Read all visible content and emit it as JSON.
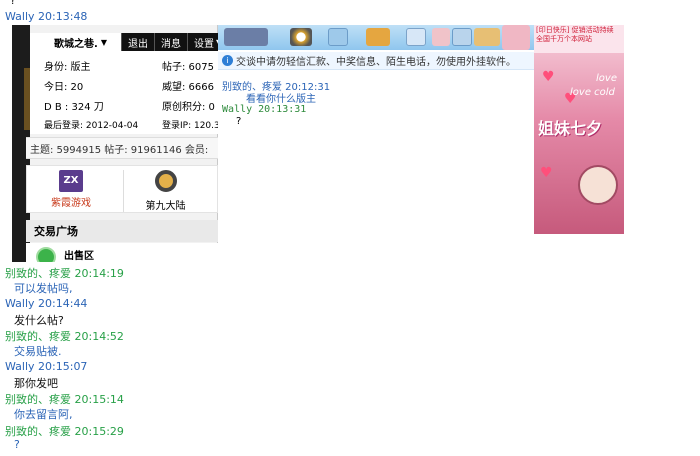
{
  "transcript_top": {
    "fragment": "?",
    "header": "Wally 20:13:48"
  },
  "forum": {
    "menu": [
      "歌城之巷.",
      "退出",
      "消息",
      "设置"
    ],
    "info": {
      "left": [
        "身份: 版主",
        "今日: 20",
        "D B : 324 刀",
        "最后登录: 2012-04-04"
      ],
      "right": [
        "帖子: 6075",
        "威望: 6666",
        "原创积分: 0",
        "登录IP: 120.3"
      ]
    },
    "stats": "主题: 5994915  帖子: 91961146  会员:",
    "apps": [
      "紫霞游戏",
      "第九大陆"
    ],
    "zx_label": "ZX",
    "section_title": "交易广场",
    "sell_label": "出售区"
  },
  "chat_panel": {
    "notice": "交谈中请勿轻信汇款、中奖信息、陌生电话，勿使用外挂软件。",
    "messages": [
      {
        "sender": "别致的、疼爱  20:12:31",
        "text": "看看你什么版主"
      },
      {
        "sender": "Wally  20:13:31",
        "text": "?"
      }
    ]
  },
  "ad": {
    "top_text": "[印日快乐] 促销活动持续\n全国千万个本网站",
    "lines": [
      "love",
      "love cold"
    ],
    "big_text": "姐妹七夕"
  },
  "transcript": [
    {
      "sender": "别致的、疼爱 20:14:19",
      "sender_color": "green",
      "text": "可以发帖吗,",
      "text_color": "blue"
    },
    {
      "sender": "Wally 20:14:44",
      "sender_color": "blue",
      "text": "发什么帖?",
      "text_color": "black"
    },
    {
      "sender": "别致的、疼爱 20:14:52",
      "sender_color": "green",
      "text": "交易贴被.",
      "text_color": "blue"
    },
    {
      "sender": "Wally 20:15:07",
      "sender_color": "blue",
      "text": "那你发吧",
      "text_color": "black"
    },
    {
      "sender": "别致的、疼爱 20:15:14",
      "sender_color": "green",
      "text": "你去留言阿,",
      "text_color": "blue"
    },
    {
      "sender": "别致的、疼爱 20:15:29",
      "sender_color": "green",
      "text": "?",
      "text_color": "blue"
    }
  ]
}
